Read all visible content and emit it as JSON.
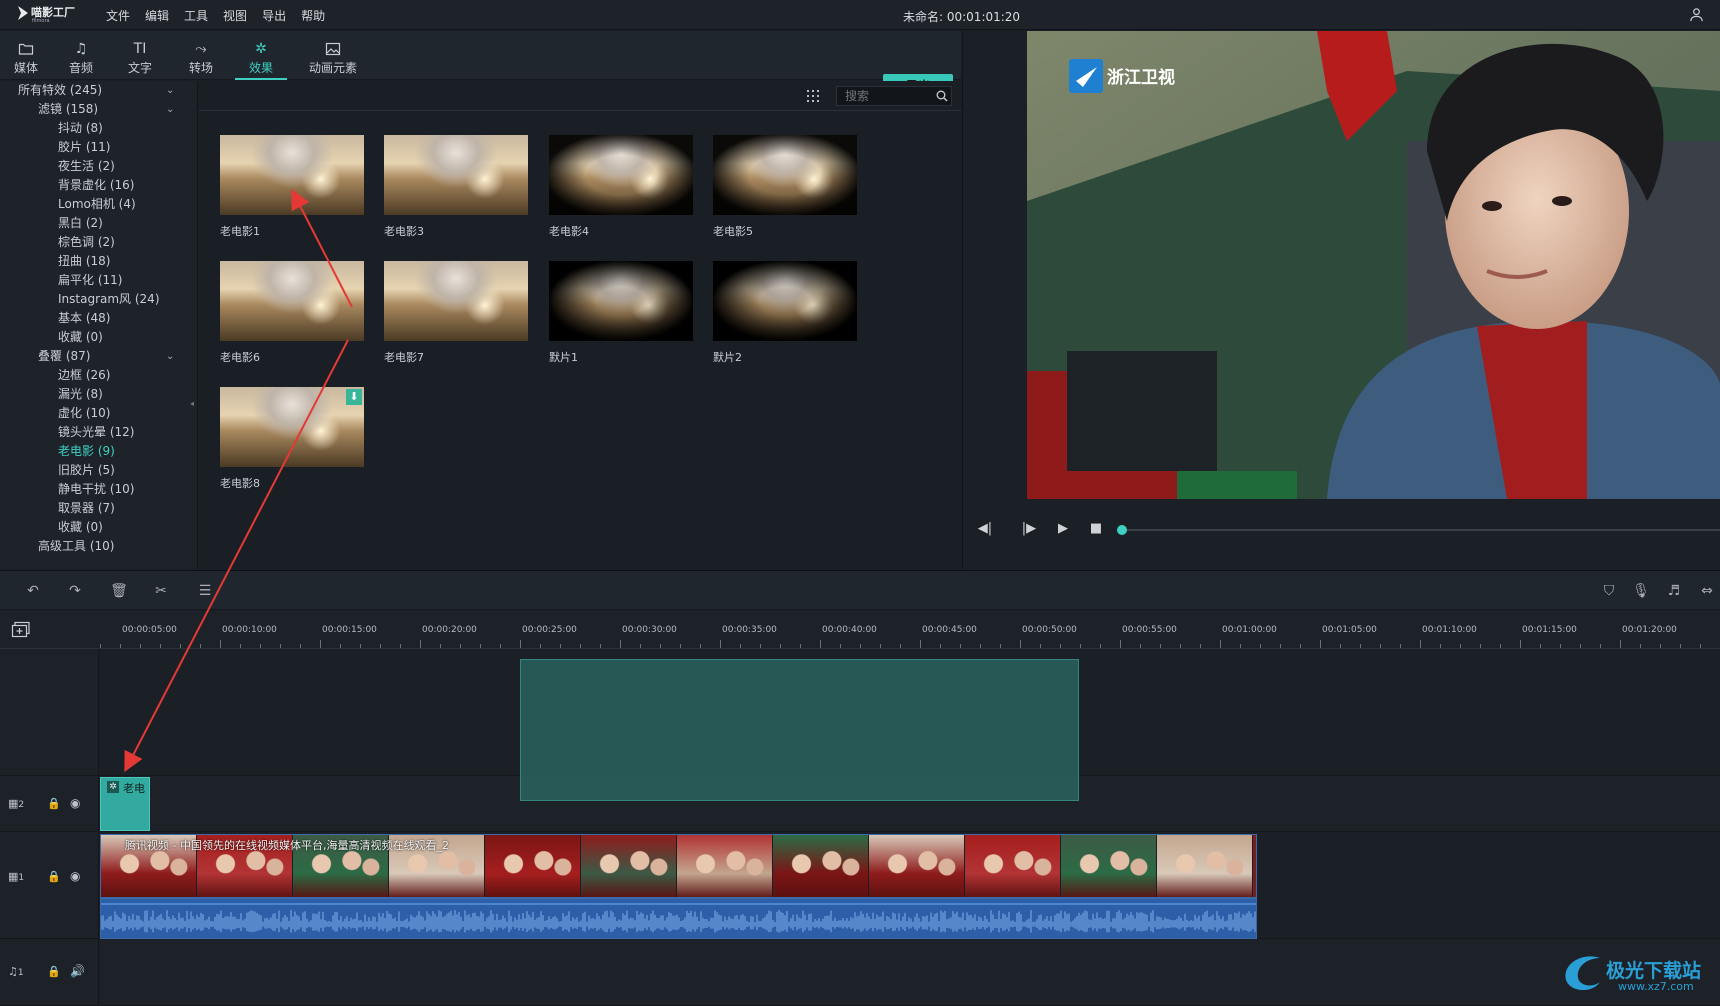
{
  "menubar": {
    "logo_text": "喵影工厂",
    "logo_sub": "filmora",
    "menus": [
      "文件",
      "编辑",
      "工具",
      "视图",
      "导出",
      "帮助"
    ],
    "doc_title": "未命名: 00:01:01:20"
  },
  "library_tabs": [
    {
      "label": "媒体",
      "icon": "folder-icon"
    },
    {
      "label": "音频",
      "icon": "music-note-icon"
    },
    {
      "label": "文字",
      "icon": "text-icon"
    },
    {
      "label": "转场",
      "icon": "transition-icon"
    },
    {
      "label": "效果",
      "icon": "effects-icon",
      "active": true
    },
    {
      "label": "动画元素",
      "icon": "image-icon"
    }
  ],
  "export_label": "导出",
  "tree": [
    {
      "label": "所有特效 (245)",
      "level": 0,
      "expanded": true
    },
    {
      "label": "滤镜 (158)",
      "level": 1,
      "expanded": true
    },
    {
      "label": "抖动 (8)",
      "level": 2
    },
    {
      "label": "胶片 (11)",
      "level": 2
    },
    {
      "label": "夜生活 (2)",
      "level": 2
    },
    {
      "label": "背景虚化 (16)",
      "level": 2
    },
    {
      "label": "Lomo相机 (4)",
      "level": 2
    },
    {
      "label": "黑白 (2)",
      "level": 2
    },
    {
      "label": "棕色调 (2)",
      "level": 2
    },
    {
      "label": "扭曲 (18)",
      "level": 2
    },
    {
      "label": "扁平化 (11)",
      "level": 2
    },
    {
      "label": "Instagram风 (24)",
      "level": 2
    },
    {
      "label": "基本 (48)",
      "level": 2
    },
    {
      "label": "收藏 (0)",
      "level": 2
    },
    {
      "label": "叠覆 (87)",
      "level": 1,
      "expanded": true
    },
    {
      "label": "边框 (26)",
      "level": 2
    },
    {
      "label": "漏光 (8)",
      "level": 2
    },
    {
      "label": "虚化 (10)",
      "level": 2
    },
    {
      "label": "镜头光晕 (12)",
      "level": 2
    },
    {
      "label": "老电影 (9)",
      "level": 2,
      "selected": true
    },
    {
      "label": "旧胶片 (5)",
      "level": 2
    },
    {
      "label": "静电干扰 (10)",
      "level": 2
    },
    {
      "label": "取景器 (7)",
      "level": 2
    },
    {
      "label": "收藏 (0)",
      "level": 2
    },
    {
      "label": "高级工具 (10)",
      "level": 1
    }
  ],
  "search": {
    "placeholder": "搜索"
  },
  "effects": [
    {
      "name": "老电影1",
      "style": "plain"
    },
    {
      "name": "老电影3",
      "style": "plain"
    },
    {
      "name": "老电影4",
      "style": "vignette"
    },
    {
      "name": "老电影5",
      "style": "vignette"
    },
    {
      "name": "老电影6",
      "style": "plain"
    },
    {
      "name": "老电影7",
      "style": "plain"
    },
    {
      "name": "默片1",
      "style": "dark"
    },
    {
      "name": "默片2",
      "style": "dark"
    },
    {
      "name": "老电影8",
      "style": "plain",
      "download": true
    }
  ],
  "preview": {
    "channel_logo": "浙江卫视"
  },
  "ruler_ticks": [
    "00:00:05:00",
    "00:00:10:00",
    "00:00:15:00",
    "00:00:20:00",
    "00:00:25:00",
    "00:00:30:00",
    "00:00:35:00",
    "00:00:40:00",
    "00:00:45:00",
    "00:00:50:00",
    "00:00:55:00",
    "00:01:00:00",
    "00:01:05:00",
    "00:01:10:00",
    "00:01:15:00",
    "00:01:20:00"
  ],
  "tracks": {
    "v2_label": "2",
    "v1_label": "1",
    "a1_label": "1",
    "fx_clip_label": "老电",
    "video_clip_title": "腾讯视频 - 中国领先的在线视频媒体平台,海量高清视频在线观看_2"
  },
  "watermark": {
    "line1": "极光下载站",
    "line2": "www.xz7.com"
  },
  "colors": {
    "accent": "#3fd0c2",
    "export_bg": "#38c9bb",
    "audio": "#2d5ea8",
    "fx_clip": "#33aaa0"
  }
}
